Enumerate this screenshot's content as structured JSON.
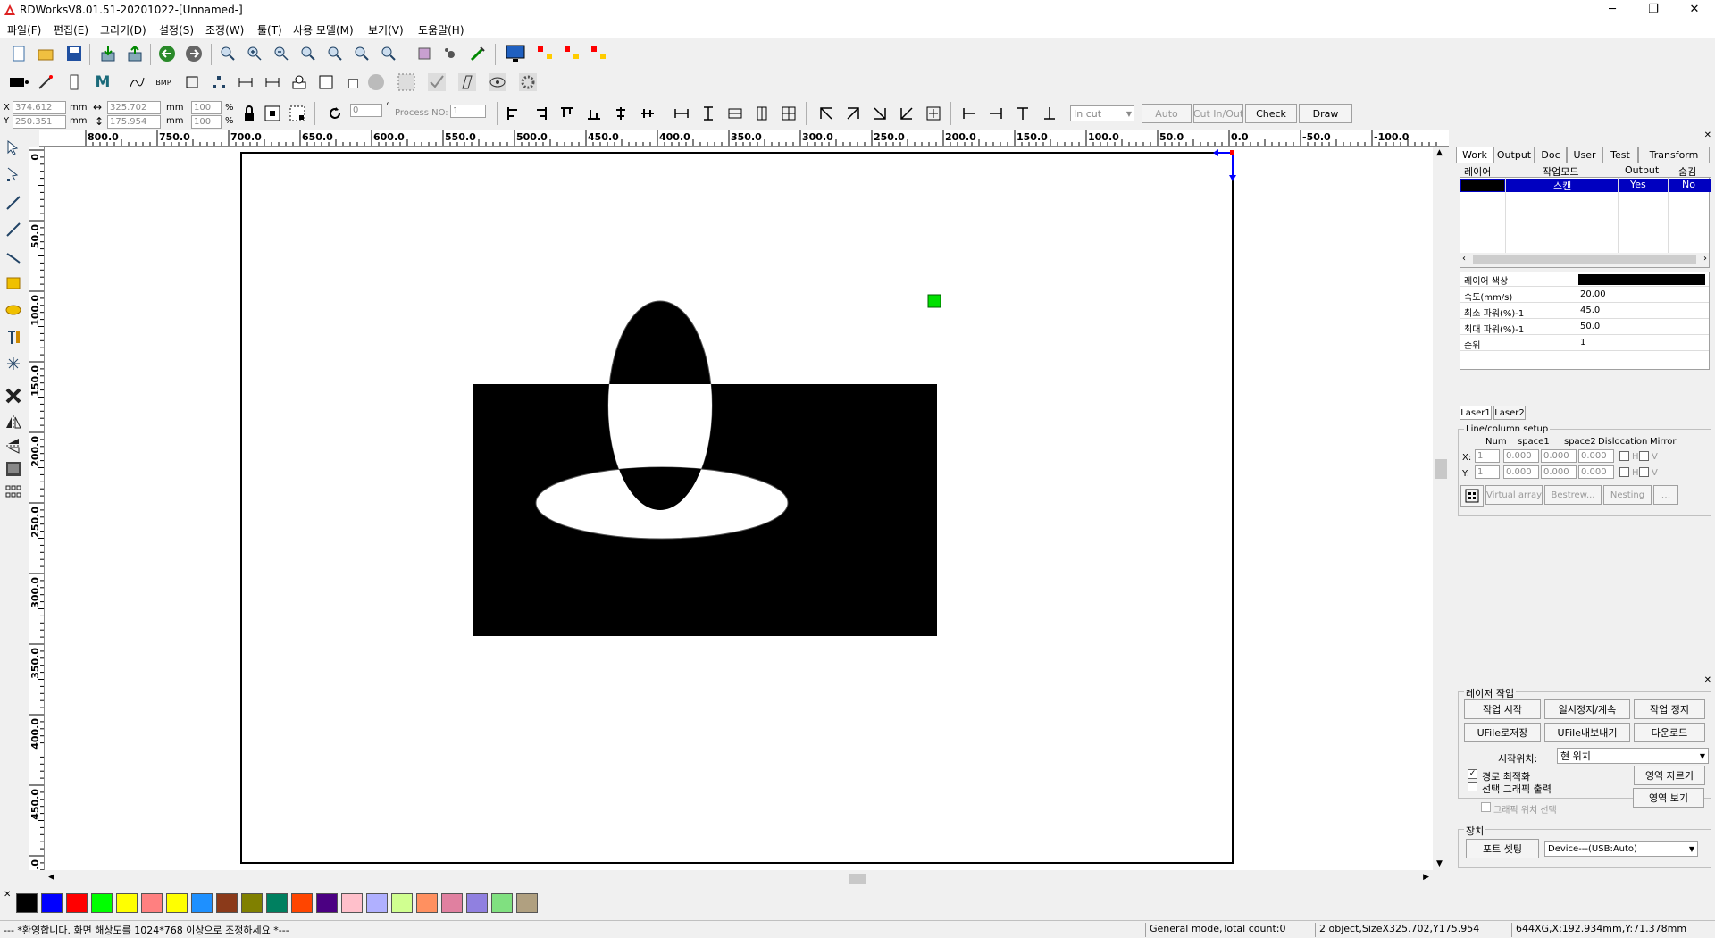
{
  "window": {
    "title": "RDWorksV8.01.51-20201022-[Unnamed-]",
    "minimize": "─",
    "restore": "❐",
    "close": "✕"
  },
  "menu": [
    "파일(F)",
    "편집(E)",
    "그리기(D)",
    "설정(S)",
    "조정(W)",
    "툴(T)",
    "사용 모델(M)",
    "보기(V)",
    "도움말(H)"
  ],
  "coords": {
    "x_label": "X",
    "y_label": "Y",
    "x_value": "374.612",
    "y_value": "250.351",
    "width_value": "325.702",
    "height_value": "175.954",
    "unit": "mm",
    "scale_x": "100",
    "scale_y": "100",
    "percent": "%",
    "rotate_value": "0",
    "degree": "°",
    "process_no_label": "Process NO:",
    "process_no_value": "1",
    "cut_mode": "In cut",
    "auto_label": "Auto",
    "cutinout_label": "Cut In/Out",
    "check_label": "Check",
    "draw_label": "Draw"
  },
  "ruler_top": [
    "800.0",
    "750.0",
    "700.0",
    "650.0",
    "600.0",
    "550.0",
    "500.0",
    "450.0",
    "400.0",
    "350.0",
    "300.0",
    "250.0",
    "200.0",
    "150.0",
    "100.0",
    "50.0",
    "0.0",
    "-50.0",
    "-100.0"
  ],
  "ruler_left": [
    "0",
    "50.0",
    "100.0",
    "150.0",
    "200.0",
    "250.0",
    "300.0",
    "350.0",
    "400.0",
    "450.0",
    "500.0"
  ],
  "right_panel": {
    "tabs": [
      "Work",
      "Output",
      "Doc",
      "User",
      "Test",
      "Transform"
    ],
    "active_tab": "Work",
    "layer_headers": [
      "레이어",
      "작업모드",
      "Output",
      "숨김"
    ],
    "layer_row": {
      "mode": "스캔",
      "output": "Yes",
      "hide": "No",
      "color": "#000000"
    },
    "props": [
      {
        "label": "레이어 색상",
        "value": ""
      },
      {
        "label": "속도(mm/s)",
        "value": "20.00"
      },
      {
        "label": "최소 파워(%)-1",
        "value": "45.0"
      },
      {
        "label": "최대 파워(%)-1",
        "value": "50.0"
      },
      {
        "label": "순위",
        "value": "1"
      }
    ],
    "laser_tabs": [
      "Laser1",
      "Laser2"
    ],
    "array_title": "Line/column setup",
    "array_headers": [
      "Num",
      "space1",
      "space2",
      "Dislocation",
      "Mirror"
    ],
    "array_x": {
      "label": "X:",
      "num": "1",
      "s1": "0.000",
      "s2": "0.000",
      "dis": "0.000"
    },
    "array_y": {
      "label": "Y:",
      "num": "1",
      "s1": "0.000",
      "s2": "0.000",
      "dis": "0.000"
    },
    "mirror_h": "H",
    "mirror_v": "V",
    "virtual_array": "Virtual array",
    "bestrew": "Bestrew...",
    "nesting": "Nesting",
    "more": "..."
  },
  "laser_work": {
    "title": "레이저 작업",
    "start": "작업 시작",
    "pause": "일시정지/계속",
    "stop": "작업 정지",
    "ufile_save": "UFile로저장",
    "ufile_export": "UFile내보내기",
    "download": "다운로드",
    "start_pos_label": "시작위치:",
    "start_pos_value": "현 위치",
    "opt_path": "경로 최적화",
    "opt_selected": "선택 그래픽 출력",
    "opt_graphic_pos": "그래픽 위치 선택",
    "cut_area": "영역 자르기",
    "view_area": "영역 보기",
    "device_title": "장치",
    "port_setting": "포트 셋팅",
    "device_value": "Device---(USB:Auto)"
  },
  "palette": [
    "#000000",
    "#0000ff",
    "#ff0000",
    "#00ff00",
    "#ffff00",
    "#ff8080",
    "#ffff00",
    "#1e90ff",
    "#8b3a1a",
    "#808000",
    "#008060",
    "#ff4500",
    "#4b0082",
    "#ffc0cb",
    "#b0b0ff",
    "#d0ff90",
    "#ff9060",
    "#e080a0",
    "#9080e0",
    "#80e080",
    "#b0a080"
  ],
  "status": {
    "message": "--- *환영합니다. 화면 해상도를 1024*768 이상으로 조정하세요 *---",
    "mode": "General mode,Total count:0",
    "selection": "2 object,SizeX325.702,Y175.954",
    "cursor": "644XG,X:192.934mm,Y:71.378mm"
  }
}
